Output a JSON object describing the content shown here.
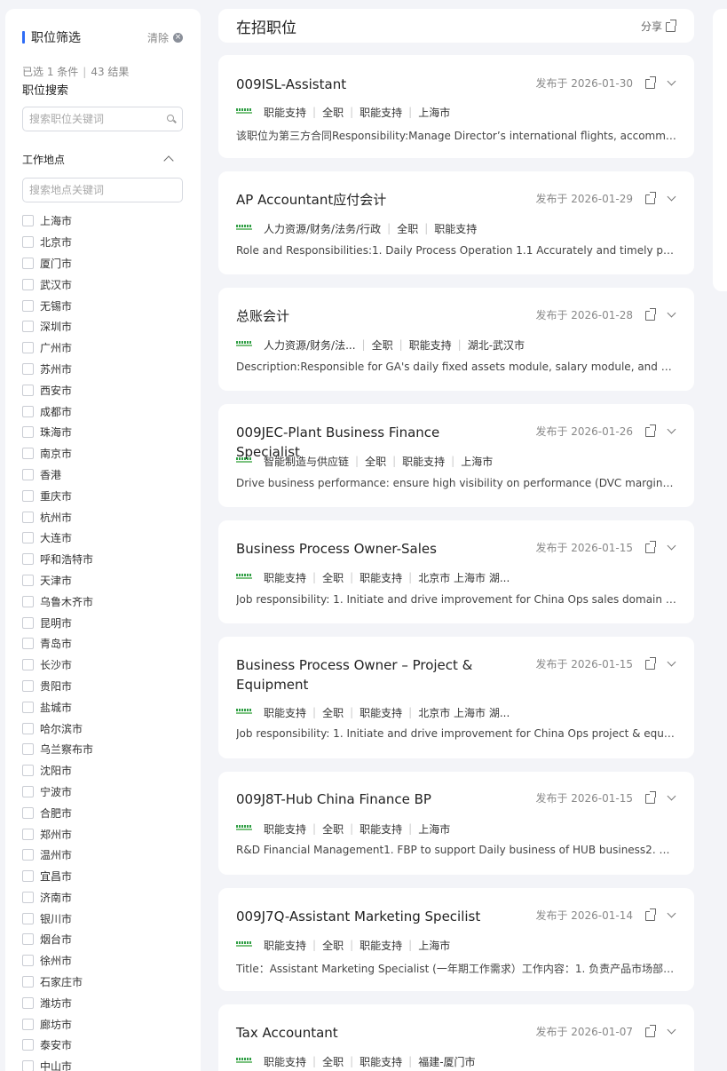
{
  "sidebar": {
    "title": "职位筛选",
    "clear_label": "清除",
    "selected_text": "已选 1 条件",
    "result_text": "43 结果",
    "sep": "|",
    "job_search_label": "职位搜索",
    "job_search_placeholder": "搜索职位关键词",
    "location_label": "工作地点",
    "location_search_placeholder": "搜索地点关键词",
    "locations": [
      "上海市",
      "北京市",
      "厦门市",
      "武汉市",
      "无锡市",
      "深圳市",
      "广州市",
      "苏州市",
      "西安市",
      "成都市",
      "珠海市",
      "南京市",
      "香港",
      "重庆市",
      "杭州市",
      "大连市",
      "呼和浩特市",
      "天津市",
      "乌鲁木齐市",
      "昆明市",
      "青岛市",
      "长沙市",
      "贵阳市",
      "盐城市",
      "哈尔滨市",
      "乌兰察布市",
      "沈阳市",
      "宁波市",
      "合肥市",
      "郑州市",
      "温州市",
      "宜昌市",
      "济南市",
      "银川市",
      "烟台市",
      "徐州市",
      "石家庄市",
      "潍坊市",
      "廊坊市",
      "泰安市",
      "中山市"
    ]
  },
  "main": {
    "title": "在招职位",
    "share_label": "分享"
  },
  "jobs": [
    {
      "title": "009ISL-Assistant",
      "date": "发布于 2026-01-30",
      "tags": [
        "职能支持",
        "全职",
        "职能支持",
        "上海市"
      ],
      "desc": "该职位为第三方合同Responsibility:Manage Director’s international flights, accommodation, ..."
    },
    {
      "title": "AP Accountant应付会计",
      "date": "发布于 2026-01-29",
      "tags": [
        "人力资源/财务/法务/行政",
        "全职",
        "职能支持"
      ],
      "desc": "Role and Responsibilities:1. Daily Process Operation 1.1 Accurately and timely process ..."
    },
    {
      "title": "总账会计",
      "date": "发布于 2026-01-28",
      "tags": [
        "人力资源/财务/法...",
        "全职",
        "职能支持",
        "湖北-武汉市"
      ],
      "desc": "Description:Responsible for GA's daily fixed assets module, salary module, and monthly ..."
    },
    {
      "title": "009JEC-Plant Business Finance Specialist",
      "date": "发布于 2026-01-26",
      "tags": [
        "智能制造与供应链",
        "全职",
        "职能支持",
        "上海市"
      ],
      "desc": "Drive business performance: ensure high visibility on performance (DVC margin evolution ..."
    },
    {
      "title": "Business Process Owner-Sales",
      "date": "发布于 2026-01-15",
      "tags": [
        "职能支持",
        "全职",
        "职能支持",
        "北京市 上海市 湖..."
      ],
      "desc": "Job responsibility: 1. Initiate and drive improvement for China Ops sales domain business ..."
    },
    {
      "title": "Business Process Owner – Project & Equipment",
      "date": "发布于 2026-01-15",
      "tags": [
        "职能支持",
        "全职",
        "职能支持",
        "北京市 上海市 湖..."
      ],
      "desc": "Job responsibility: 1. Initiate and drive improvement for China Ops project & equipment ..."
    },
    {
      "title": "009J8T-Hub China Finance BP",
      "date": "发布于 2026-01-15",
      "tags": [
        "职能支持",
        "全职",
        "职能支持",
        "上海市"
      ],
      "desc": "R&D Financial Management1. FBP to support Daily business of HUB business2. Responsible ..."
    },
    {
      "title": "009J7Q-Assistant Marketing Specilist",
      "date": "发布于 2026-01-14",
      "tags": [
        "职能支持",
        "全职",
        "职能支持",
        "上海市"
      ],
      "desc": "Title：Assistant Marketing Specialist (一年期工作需求）工作内容：1. 负责产品市场部业务 ..."
    },
    {
      "title": "Tax Accountant",
      "date": "发布于 2026-01-07",
      "tags": [
        "职能支持",
        "全职",
        "职能支持",
        "福建-厦门市"
      ],
      "desc": ""
    }
  ]
}
